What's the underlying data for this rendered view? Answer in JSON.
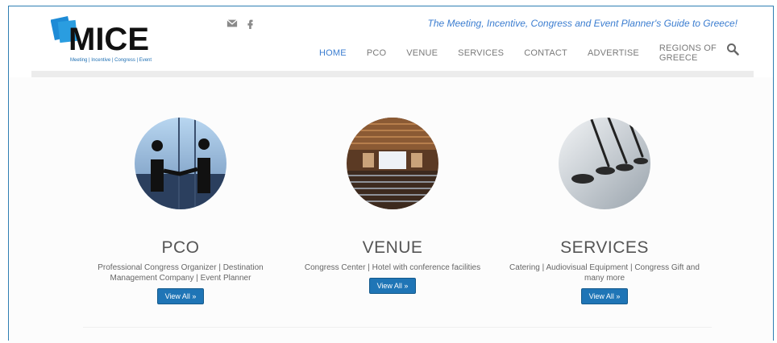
{
  "site": {
    "logo_text": "MICE",
    "logo_sub": "Meeting | Incentive | Congress | Event",
    "tagline": "The Meeting, Incentive, Congress and Event Planner's Guide to Greece!"
  },
  "social": {
    "icons": [
      "envelope-icon",
      "facebook-icon"
    ]
  },
  "nav": {
    "items": [
      {
        "label": "HOME",
        "active": true
      },
      {
        "label": "PCO"
      },
      {
        "label": "VENUE"
      },
      {
        "label": "SERVICES"
      },
      {
        "label": "CONTACT"
      },
      {
        "label": "ADVERTISE"
      },
      {
        "label": "REGIONS OF GREECE"
      }
    ]
  },
  "sections": [
    {
      "title": "PCO",
      "text": "Professional Congress Organizer | Destination Management Company | Event Planner",
      "button": "View All »"
    },
    {
      "title": "VENUE",
      "text": "Congress Center | Hotel with conference facilities",
      "button": "View All »"
    },
    {
      "title": "SERVICES",
      "text": "Catering | Audiovisual Equipment | Congress Gift and many more",
      "button": "View All »"
    }
  ],
  "colors": {
    "accent": "#3b7dd0",
    "button": "#1f75b6",
    "frame": "#2f7fb3"
  }
}
